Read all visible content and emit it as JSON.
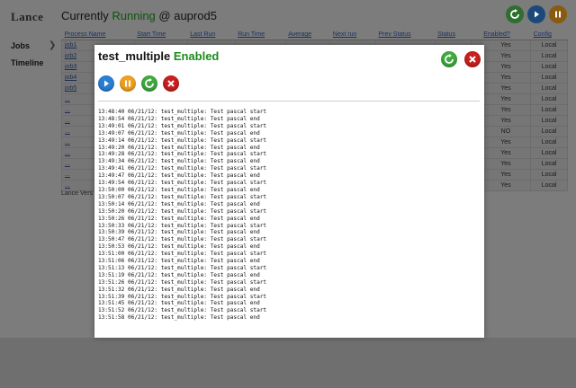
{
  "header": {
    "brand": "Lance",
    "prefix": "Currently ",
    "status": "Running",
    "suffix": " @ auprod5"
  },
  "sidebar": {
    "items": [
      {
        "label": "Jobs"
      },
      {
        "label": "Timeline"
      }
    ]
  },
  "table": {
    "columns": [
      "Process Name",
      "Start Time",
      "Last Run",
      "Run Time",
      "Average",
      "Next run",
      "Prev Status",
      "Status",
      "",
      "Enabled?",
      "Config"
    ],
    "rows": [
      {
        "name": "job1",
        "enabled": "Yes",
        "config": "Local"
      },
      {
        "name": "job2",
        "enabled": "Yes",
        "config": "Local"
      },
      {
        "name": "job3",
        "enabled": "Yes",
        "config": "Local"
      },
      {
        "name": "job4",
        "enabled": "Yes",
        "config": "Local"
      },
      {
        "name": "job5",
        "enabled": "Yes",
        "config": "Local"
      },
      {
        "name": "...",
        "enabled": "Yes",
        "config": "Local"
      },
      {
        "name": "...",
        "enabled": "Yes",
        "config": "Local"
      },
      {
        "name": "...",
        "enabled": "Yes",
        "config": "Local"
      },
      {
        "name": "...",
        "enabled": "NO",
        "config": "Local"
      },
      {
        "name": "...",
        "enabled": "Yes",
        "config": "Local"
      },
      {
        "name": "...",
        "enabled": "Yes",
        "config": "Local"
      },
      {
        "name": "...",
        "enabled": "Yes",
        "config": "Local"
      },
      {
        "name": "...",
        "enabled": "Yes",
        "config": "Local"
      },
      {
        "name": "...",
        "enabled": "Yes",
        "config": "Local"
      }
    ],
    "footer": "Lance Vers"
  },
  "modal": {
    "job_name": "test_multiple",
    "state": "Enabled",
    "log_lines": [
      "13:48:40 06/21/12: test_multiple: Test pascal start",
      "13:48:54 06/21/12: test_multiple: Test pascal end",
      "13:49:01 06/21/12: test_multiple: Test pascal start",
      "13:49:07 06/21/12: test_multiple: Test pascal end",
      "13:49:14 06/21/12: test_multiple: Test pascal start",
      "13:49:20 06/21/12: test_multiple: Test pascal end",
      "13:49:28 06/21/12: test_multiple: Test pascal start",
      "13:49:34 06/21/12: test_multiple: Test pascal end",
      "13:49:41 06/21/12: test_multiple: Test pascal start",
      "13:49:47 06/21/12: test_multiple: Test pascal end",
      "13:49:54 06/21/12: test_multiple: Test pascal start",
      "13:50:00 06/21/12: test_multiple: Test pascal end",
      "13:50:07 06/21/12: test_multiple: Test pascal start",
      "13:50:14 06/21/12: test_multiple: Test pascal end",
      "13:50:20 06/21/12: test_multiple: Test pascal start",
      "13:50:26 06/21/12: test_multiple: Test pascal end",
      "13:50:33 06/21/12: test_multiple: Test pascal start",
      "13:50:39 06/21/12: test_multiple: Test pascal end",
      "13:50:47 06/21/12: test_multiple: Test pascal start",
      "13:50:53 06/21/12: test_multiple: Test pascal end",
      "13:51:00 06/21/12: test_multiple: Test pascal start",
      "13:51:06 06/21/12: test_multiple: Test pascal end",
      "13:51:13 06/21/12: test_multiple: Test pascal start",
      "13:51:19 06/21/12: test_multiple: Test pascal end",
      "13:51:26 06/21/12: test_multiple: Test pascal start",
      "13:51:32 06/21/12: test_multiple: Test pascal end",
      "13:51:39 06/21/12: test_multiple: Test pascal start",
      "13:51:45 06/21/12: test_multiple: Test pascal end",
      "13:51:52 06/21/12: test_multiple: Test pascal start",
      "13:51:58 06/21/12: test_multiple: Test pascal end"
    ]
  },
  "icons": {
    "top": [
      "refresh-icon",
      "play-icon",
      "pause-icon"
    ],
    "modal_top": [
      "refresh-icon",
      "close-icon"
    ],
    "modal_controls": [
      "play-icon",
      "pause-icon",
      "restart-icon",
      "stop-icon"
    ]
  },
  "colors": {
    "running": "#0c540c",
    "enabled": "#1b8a1b",
    "close": "#c81f1f",
    "play": "#2a7fd4",
    "pause": "#f0a020"
  }
}
